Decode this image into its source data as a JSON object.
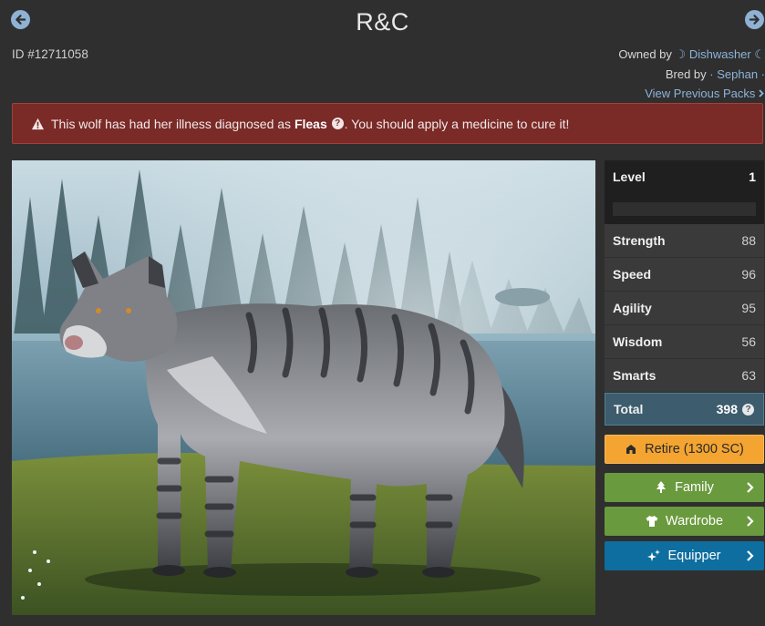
{
  "header": {
    "title": "R&C",
    "id_text": "ID #12711058",
    "owned_by_label": "Owned by",
    "owner_name": "☽ Dishwasher ☾",
    "bred_by_label": "Bred by",
    "breeder_name": "· Sephan ·",
    "view_previous_packs": "View Previous Packs",
    "prev_icon": "arrow-left-circle-icon",
    "next_icon": "arrow-right-circle-icon"
  },
  "alert": {
    "icon": "warning-triangle-icon",
    "before": "This wolf has had her illness diagnosed as",
    "illness": "Fleas",
    "after": ". You should apply a medicine to cure it!",
    "color": "#7a2a27"
  },
  "stats": {
    "level_label": "Level",
    "level_value": "1",
    "xp_progress": 0,
    "rows": [
      {
        "label": "Strength",
        "value": "88"
      },
      {
        "label": "Speed",
        "value": "96"
      },
      {
        "label": "Agility",
        "value": "95"
      },
      {
        "label": "Wisdom",
        "value": "56"
      },
      {
        "label": "Smarts",
        "value": "63"
      }
    ],
    "total_label": "Total",
    "total_value": "398"
  },
  "buttons": {
    "retire": {
      "label": "Retire (1300 SC)",
      "icon": "retire-building-icon",
      "color": "#f3a431"
    },
    "family": {
      "label": "Family",
      "icon": "tree-icon",
      "color": "#6a9a3e"
    },
    "wardrobe": {
      "label": "Wardrobe",
      "icon": "shirt-icon",
      "color": "#6a9a3e"
    },
    "equipper": {
      "label": "Equipper",
      "icon": "sparkles-icon",
      "color": "#0e6e9f"
    }
  },
  "image": {
    "subject": "grey striped wolf standing by a misty lake"
  }
}
